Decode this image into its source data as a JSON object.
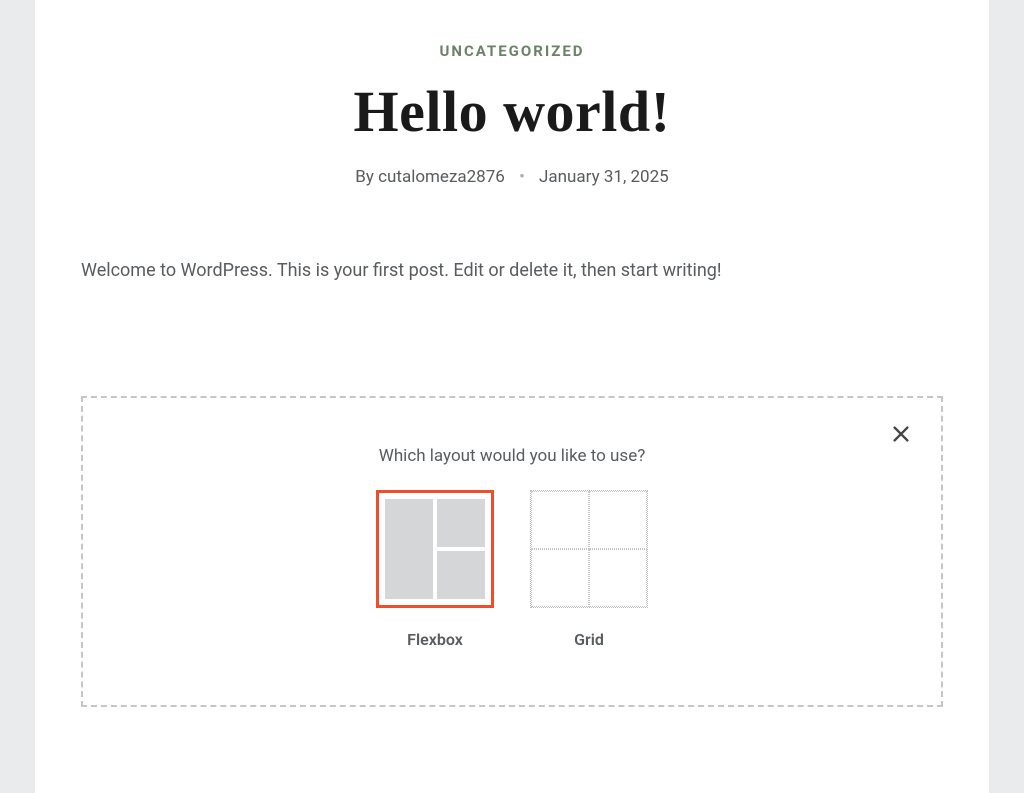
{
  "post": {
    "category": "UNCATEGORIZED",
    "title": "Hello world!",
    "by_prefix": "By",
    "author": "cutalomeza2876",
    "date": "January 31, 2025",
    "content": "Welcome to WordPress. This is your first post. Edit or delete it, then start writing!"
  },
  "layout_picker": {
    "prompt": "Which layout would you like to use?",
    "options": {
      "flexbox": {
        "label": "Flexbox",
        "selected": true
      },
      "grid": {
        "label": "Grid",
        "selected": false
      }
    },
    "close_icon": "close-icon"
  },
  "colors": {
    "category": "#6b8268",
    "accent": "#f04d2d"
  }
}
